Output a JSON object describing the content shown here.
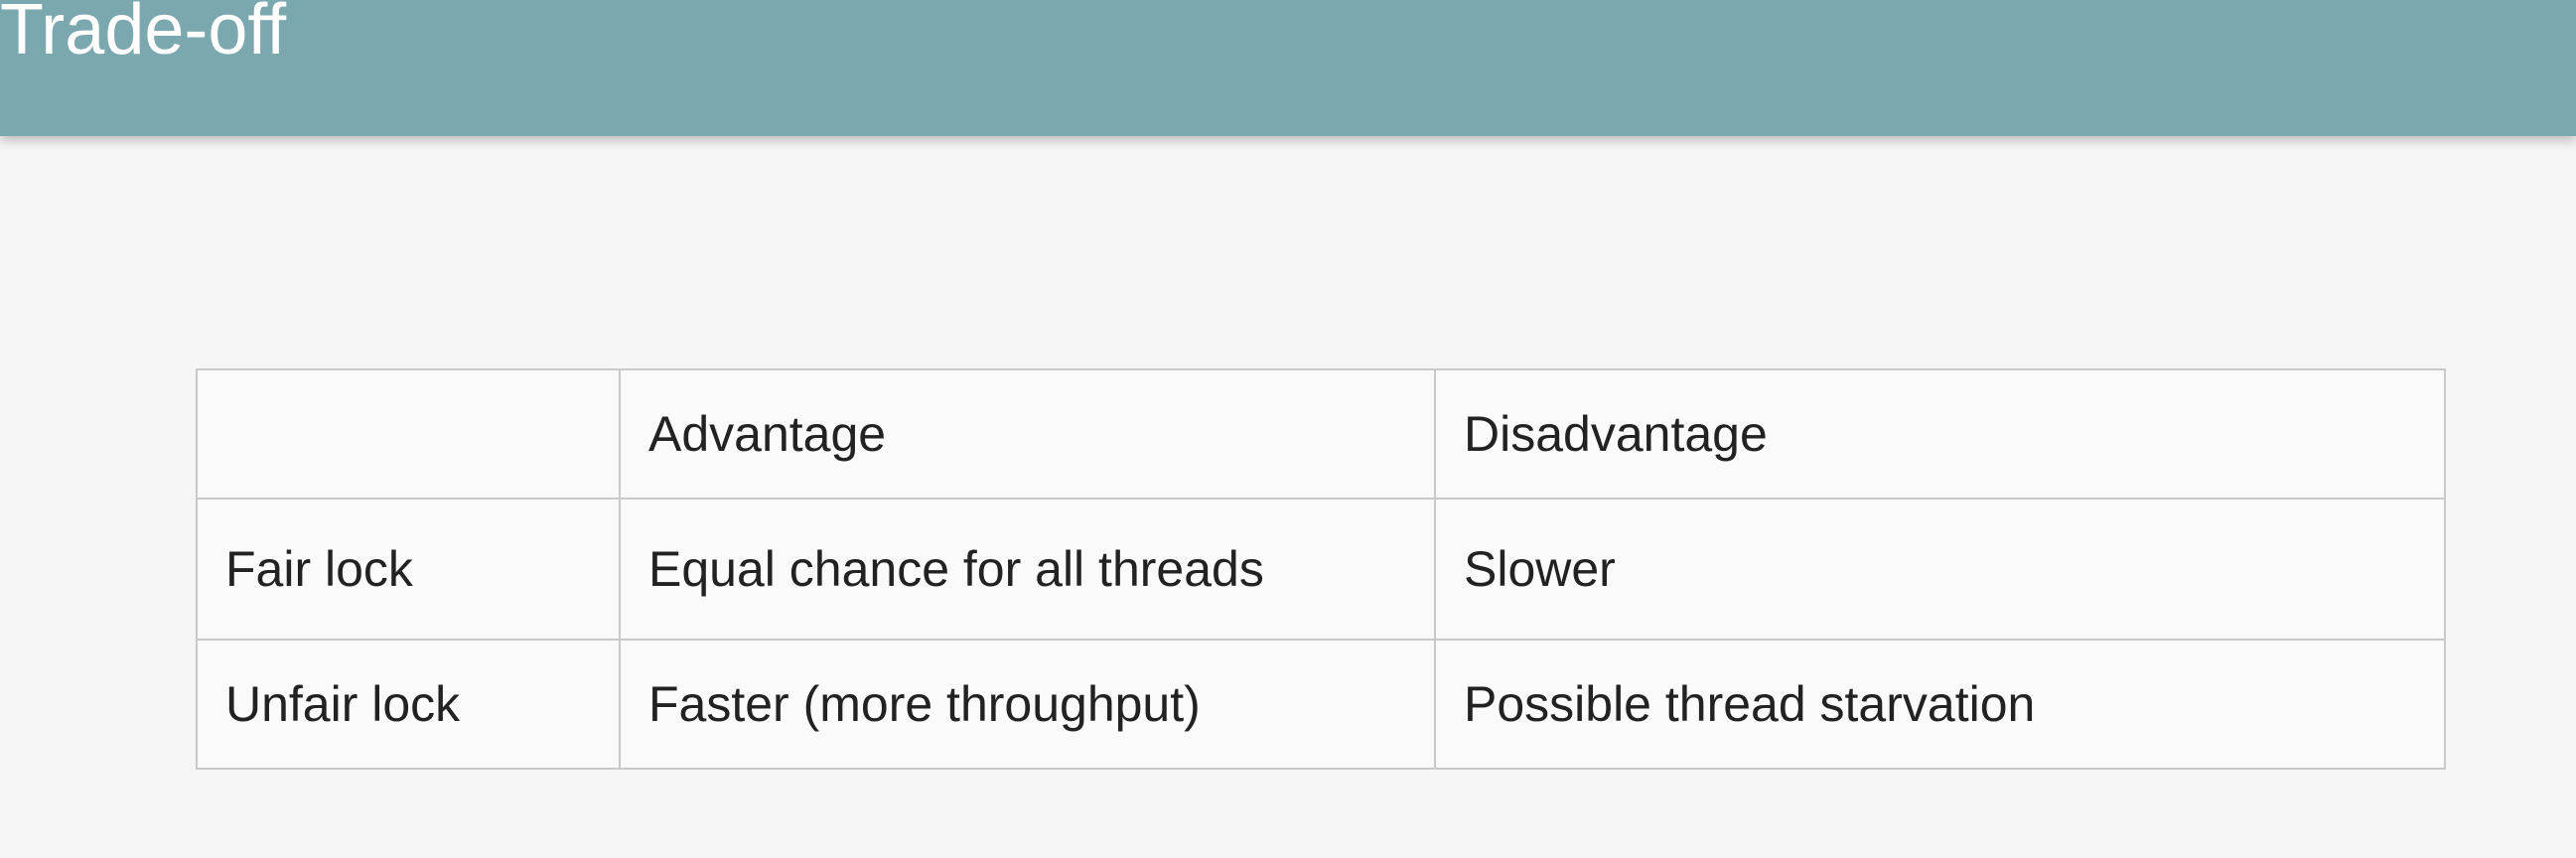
{
  "header": {
    "title": "Trade-off"
  },
  "table": {
    "columns": [
      "",
      "Advantage",
      "Disadvantage"
    ],
    "rows": [
      [
        "Fair lock",
        "Equal chance for all threads",
        "Slower"
      ],
      [
        "Unfair lock",
        "Faster (more throughput)",
        "Possible thread starvation"
      ]
    ]
  },
  "colors": {
    "header_background": "#7ba8ae",
    "page_background": "#f5f5f5",
    "border": "#c9c9c9",
    "text": "#222222"
  }
}
